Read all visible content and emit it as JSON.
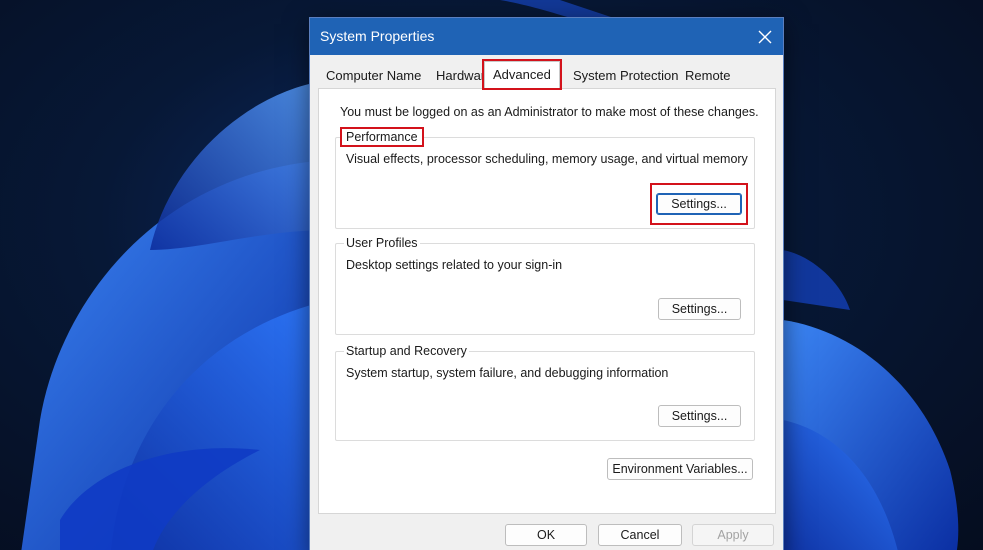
{
  "window": {
    "title": "System Properties",
    "close_icon": "close-icon"
  },
  "tabs": [
    {
      "label": "Computer Name",
      "active": false
    },
    {
      "label": "Hardware",
      "active": false
    },
    {
      "label": "Advanced",
      "active": true,
      "highlighted": true
    },
    {
      "label": "System Protection",
      "active": false
    },
    {
      "label": "Remote",
      "active": false
    }
  ],
  "advanced": {
    "admin_note": "You must be logged on as an Administrator to make most of these changes.",
    "performance": {
      "title": "Performance",
      "title_highlighted": true,
      "description": "Visual effects, processor scheduling, memory usage, and virtual memory",
      "settings_label": "Settings...",
      "settings_highlighted": true
    },
    "user_profiles": {
      "title": "User Profiles",
      "description": "Desktop settings related to your sign-in",
      "settings_label": "Settings..."
    },
    "startup_recovery": {
      "title": "Startup and Recovery",
      "description": "System startup, system failure, and debugging information",
      "settings_label": "Settings..."
    },
    "env_variables_label": "Environment Variables..."
  },
  "footer": {
    "ok_label": "OK",
    "cancel_label": "Cancel",
    "apply_label": "Apply",
    "apply_enabled": false
  },
  "colors": {
    "titlebar": "#1f63b5",
    "highlight": "#d3121b",
    "wallpaper_dark": "#050d1f",
    "wallpaper_bloom": "#1a4fd8"
  }
}
